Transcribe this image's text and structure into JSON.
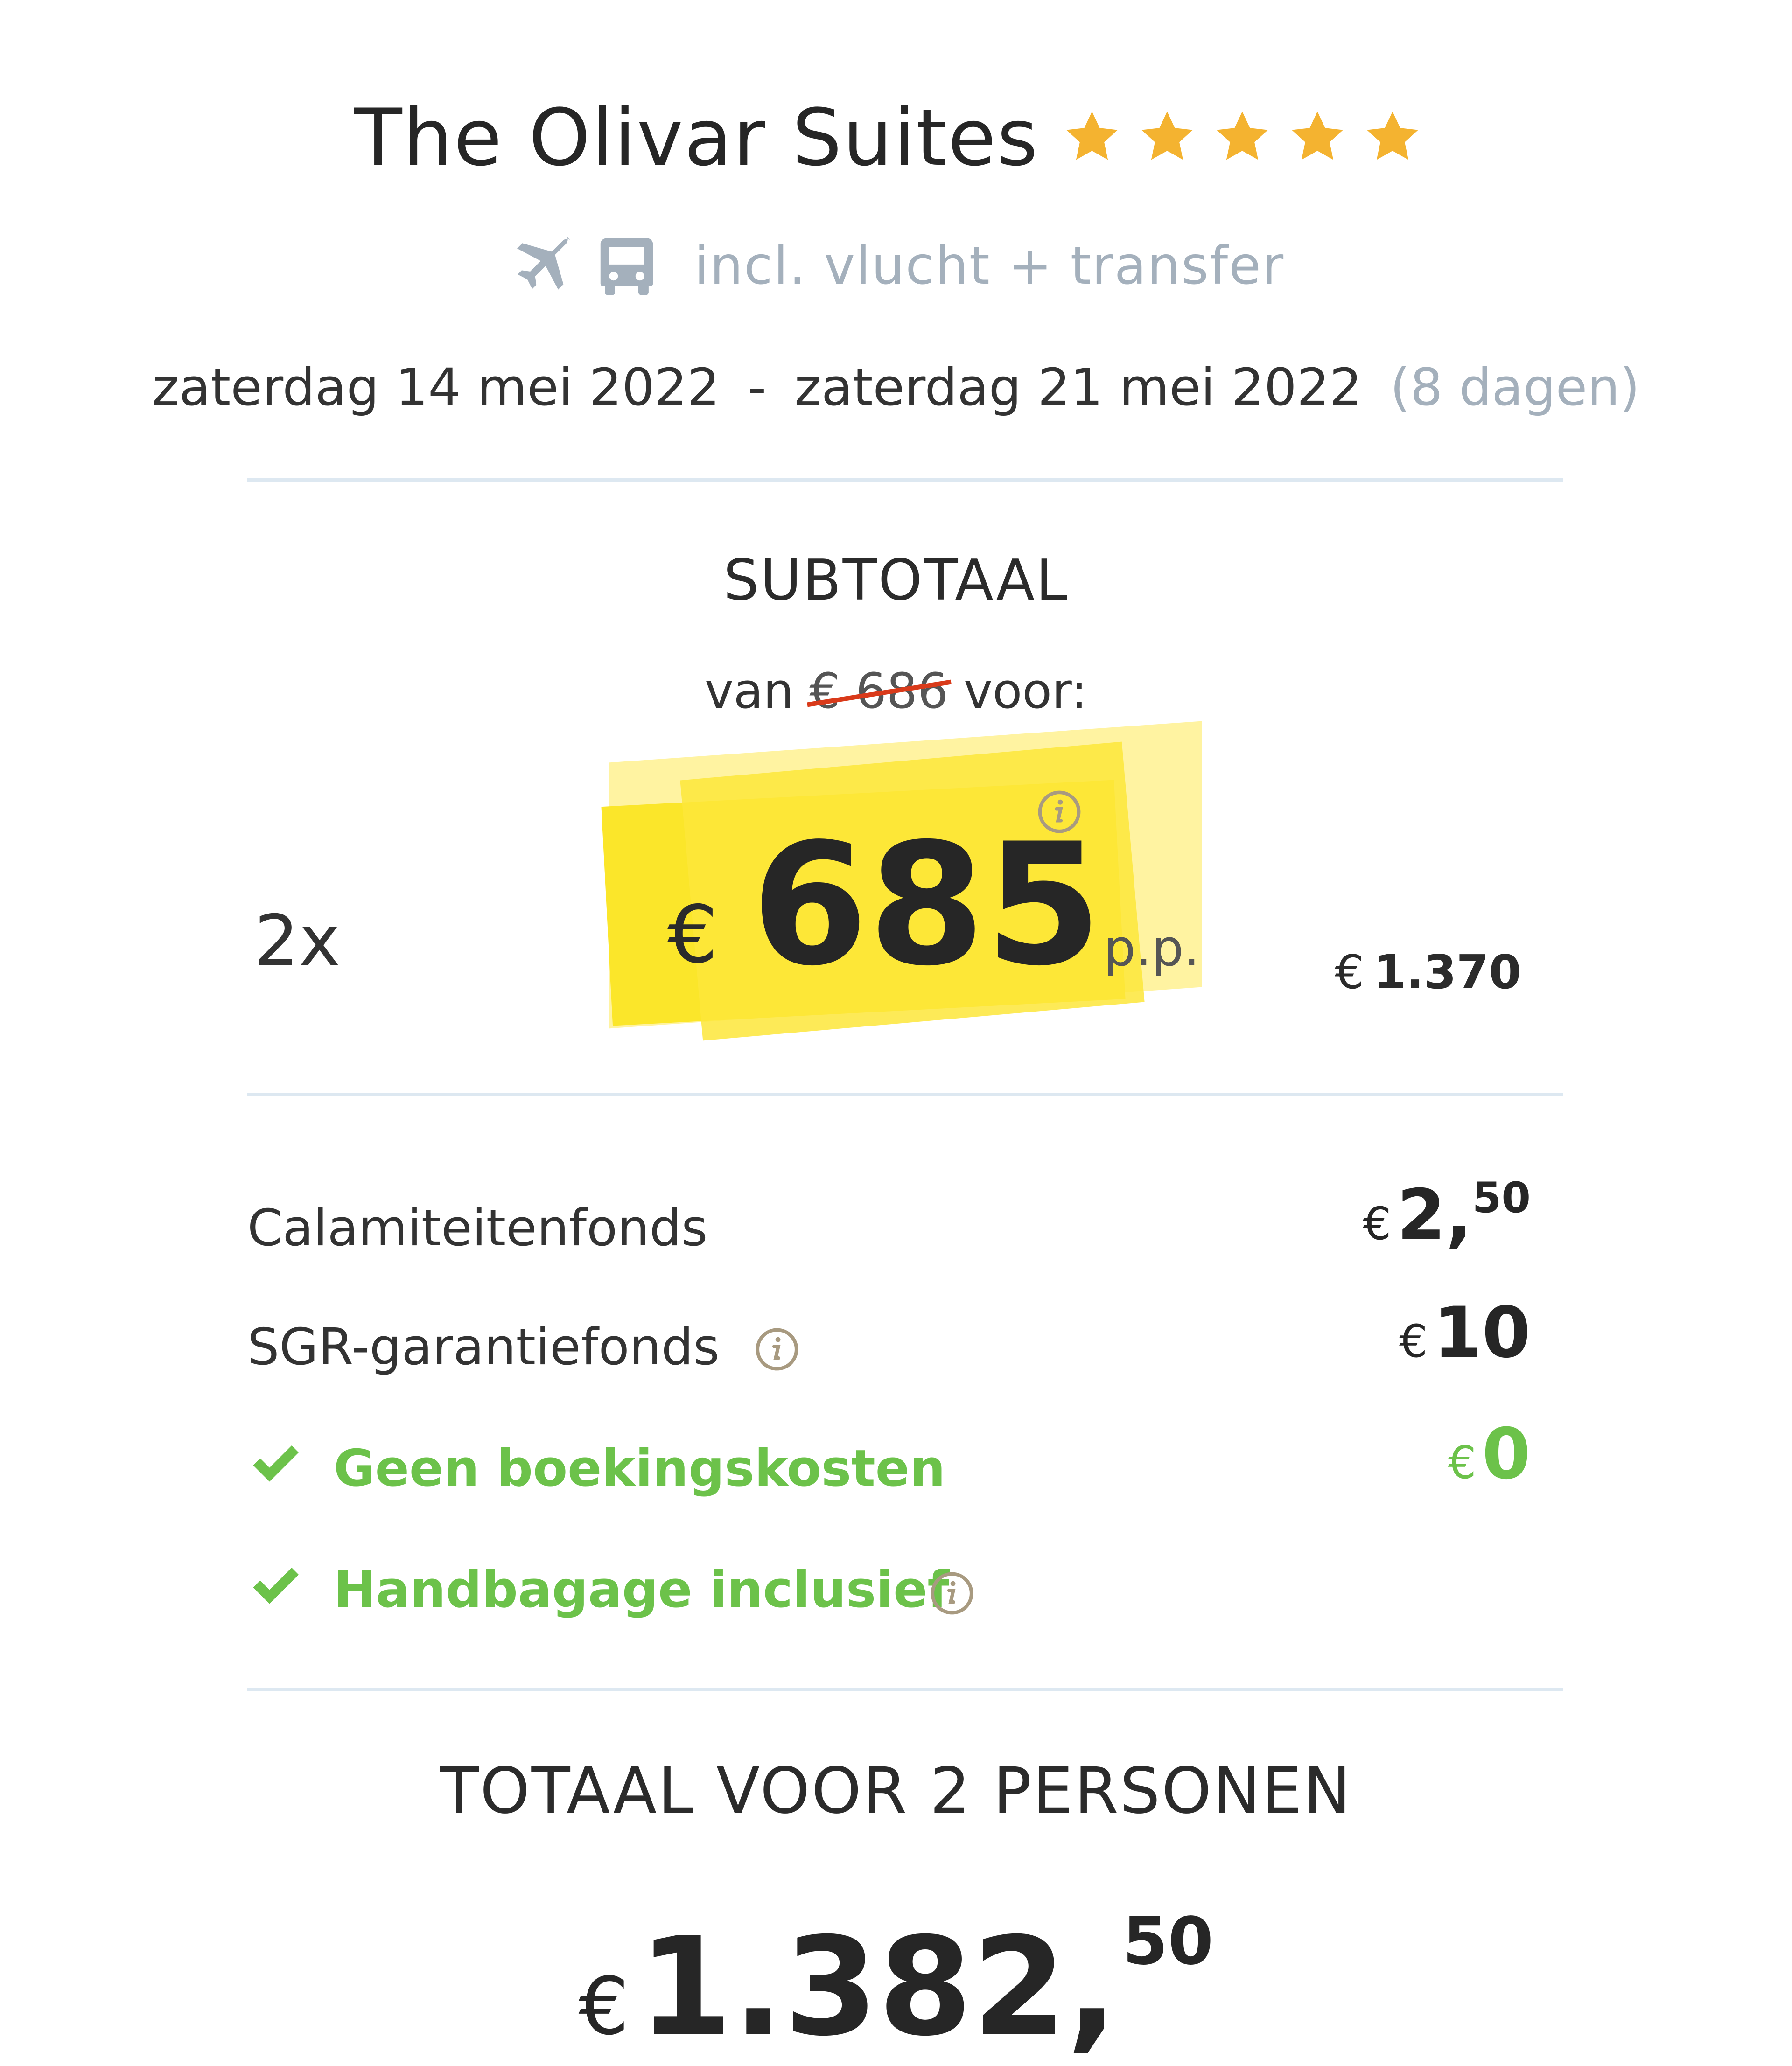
{
  "header": {
    "hotel_name": "The Olivar Suites",
    "star_rating": 5,
    "star_color": "#f4b330",
    "included_text": "incl. vlucht + transfer",
    "included_icons": [
      "plane-icon",
      "bus-icon"
    ],
    "date_start": "zaterdag 14 mei 2022",
    "date_separator": "-",
    "date_end": "zaterdag 21 mei 2022",
    "duration": "(8 dagen)"
  },
  "subtotal": {
    "title": "SUBTOTAAL",
    "from_prefix": "van",
    "old_price": "€ 686",
    "from_suffix": "voor:",
    "quantity": "2x",
    "currency": "€",
    "price_per_person": "685",
    "per_person_label": "p.p.",
    "amount_currency": "€",
    "amount": "1.370",
    "highlight_color": "#fbe62a"
  },
  "fees": [
    {
      "label": "Calamiteitenfonds",
      "currency": "€",
      "integer": "2,",
      "decimal": "50"
    },
    {
      "label": "SGR-garantiefonds",
      "currency": "€",
      "integer": "10",
      "decimal": ""
    },
    {
      "label": "Geen boekingskosten",
      "currency": "€",
      "integer": "0",
      "decimal": ""
    },
    {
      "label": "Handbagage inclusief"
    }
  ],
  "total": {
    "title": "TOTAAL VOOR 2 PERSONEN",
    "currency": "€",
    "integer": "1.382,",
    "decimal": "50"
  },
  "colors": {
    "accent_green": "#6cc24a",
    "muted": "#a4b0bc",
    "strike_red": "#d93a1a",
    "divider": "#dde8f1"
  }
}
